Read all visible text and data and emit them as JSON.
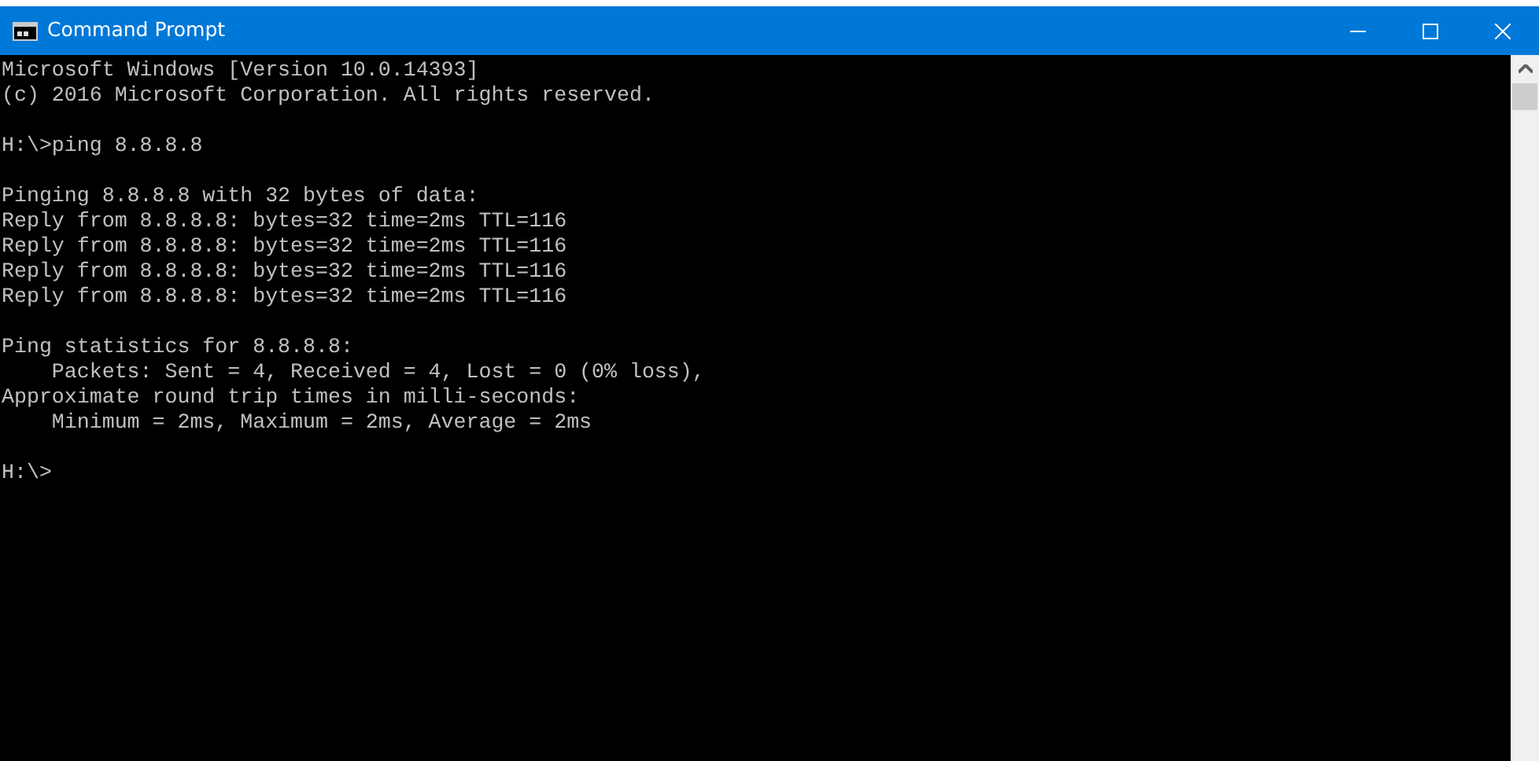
{
  "window": {
    "title": "Command Prompt"
  },
  "console": {
    "blocks": [
      [
        "Microsoft Windows [Version 10.0.14393]",
        "(c) 2016 Microsoft Corporation. All rights reserved."
      ],
      [
        "H:\\>ping 8.8.8.8"
      ],
      [
        "Pinging 8.8.8.8 with 32 bytes of data:",
        "Reply from 8.8.8.8: bytes=32 time=2ms TTL=116",
        "Reply from 8.8.8.8: bytes=32 time=2ms TTL=116",
        "Reply from 8.8.8.8: bytes=32 time=2ms TTL=116",
        "Reply from 8.8.8.8: bytes=32 time=2ms TTL=116"
      ],
      [
        "Ping statistics for 8.8.8.8:",
        "    Packets: Sent = 4, Received = 4, Lost = 0 (0% loss),",
        "Approximate round trip times in milli-seconds:",
        "    Minimum = 2ms, Maximum = 2ms, Average = 2ms"
      ],
      [
        "H:\\>"
      ]
    ]
  }
}
